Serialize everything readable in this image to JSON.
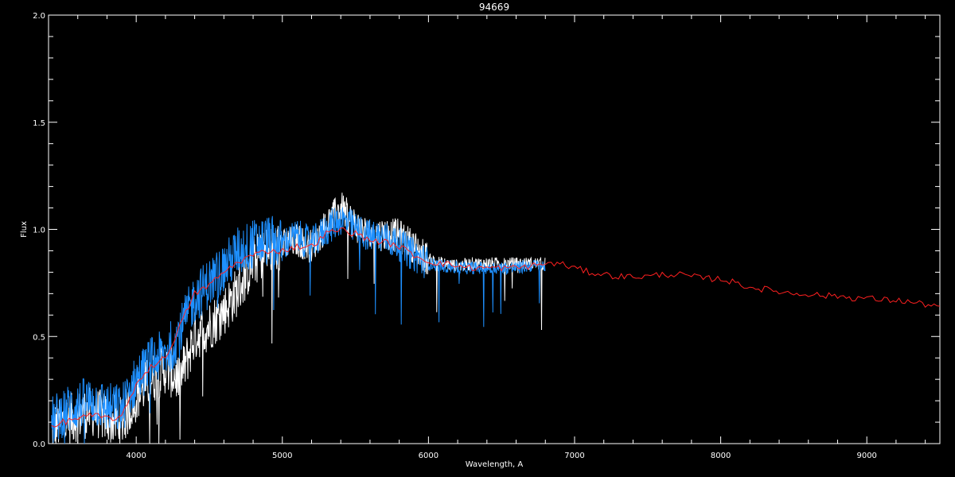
{
  "chart_data": {
    "type": "line",
    "title": "94669",
    "xlabel": "Wavelength, A",
    "ylabel": "Flux",
    "xlim": [
      3400,
      9500
    ],
    "ylim": [
      0.0,
      2.0
    ],
    "x_ticks": [
      4000,
      5000,
      6000,
      7000,
      8000,
      9000
    ],
    "y_ticks": [
      0.0,
      0.5,
      1.0,
      1.5,
      2.0
    ],
    "x_tick_labels": [
      "4000",
      "5000",
      "6000",
      "7000",
      "8000",
      "9000"
    ],
    "y_tick_labels": [
      "0.0",
      "0.5",
      "1.0",
      "1.5",
      "2.0"
    ],
    "grid": false,
    "background": "#000000",
    "axes_color": "#ffffff",
    "series": [
      {
        "color": "#ffffff",
        "x": [
          3420,
          3500,
          3600,
          3700,
          3800,
          3900,
          4000,
          4100,
          4200,
          4300,
          4400,
          4500,
          4600,
          4700,
          4800,
          4900,
          5000,
          5100,
          5200,
          5300,
          5400,
          5500,
          5600,
          5700,
          5800,
          5900,
          6000,
          6100,
          6200,
          6300,
          6400,
          6500,
          6600,
          6700,
          6800
        ],
        "y": [
          0.07,
          0.1,
          0.13,
          0.15,
          0.12,
          0.1,
          0.22,
          0.3,
          0.35,
          0.3,
          0.5,
          0.55,
          0.62,
          0.72,
          0.85,
          0.9,
          0.92,
          0.95,
          0.92,
          1.02,
          1.1,
          1.02,
          0.97,
          0.98,
          0.97,
          0.92,
          0.86,
          0.84,
          0.83,
          0.84,
          0.84,
          0.84,
          0.84,
          0.84,
          0.84
        ]
      },
      {
        "color": "#1e90ff",
        "x": [
          3420,
          3500,
          3600,
          3700,
          3800,
          3900,
          4000,
          4100,
          4200,
          4300,
          4400,
          4500,
          4600,
          4700,
          4800,
          4900,
          5000,
          5100,
          5200,
          5300,
          5400,
          5500,
          5600,
          5700,
          5800,
          5900,
          6000,
          6100,
          6200,
          6300,
          6400,
          6500,
          6600,
          6700,
          6800
        ],
        "y": [
          0.1,
          0.15,
          0.18,
          0.2,
          0.17,
          0.16,
          0.3,
          0.38,
          0.42,
          0.52,
          0.68,
          0.75,
          0.82,
          0.9,
          0.93,
          0.95,
          0.93,
          0.97,
          0.93,
          1.0,
          1.05,
          1.0,
          0.97,
          0.96,
          0.93,
          0.88,
          0.84,
          0.83,
          0.82,
          0.82,
          0.82,
          0.82,
          0.82,
          0.83,
          0.83
        ]
      },
      {
        "color": "#ff2020",
        "x": [
          3420,
          3500,
          3600,
          3700,
          3800,
          3900,
          4000,
          4100,
          4200,
          4300,
          4400,
          4500,
          4600,
          4700,
          4800,
          4900,
          5000,
          5100,
          5200,
          5300,
          5400,
          5500,
          5600,
          5700,
          5800,
          5900,
          6000,
          6100,
          6200,
          6300,
          6400,
          6500,
          6600,
          6700,
          6800,
          6900,
          7000,
          7100,
          7200,
          7300,
          7400,
          7500,
          7600,
          7700,
          7800,
          7900,
          8000,
          8100,
          8200,
          8300,
          8400,
          8500,
          8600,
          8700,
          8800,
          8900,
          9000,
          9100,
          9200,
          9300,
          9400,
          9500
        ],
        "y": [
          0.07,
          0.1,
          0.12,
          0.13,
          0.12,
          0.12,
          0.28,
          0.36,
          0.4,
          0.55,
          0.7,
          0.74,
          0.8,
          0.85,
          0.88,
          0.9,
          0.9,
          0.92,
          0.92,
          0.98,
          1.0,
          0.98,
          0.95,
          0.94,
          0.92,
          0.88,
          0.85,
          0.84,
          0.83,
          0.82,
          0.82,
          0.82,
          0.82,
          0.83,
          0.84,
          0.84,
          0.82,
          0.8,
          0.79,
          0.78,
          0.78,
          0.78,
          0.79,
          0.79,
          0.78,
          0.77,
          0.77,
          0.75,
          0.73,
          0.72,
          0.71,
          0.7,
          0.7,
          0.69,
          0.69,
          0.68,
          0.68,
          0.67,
          0.67,
          0.66,
          0.65,
          0.64
        ]
      }
    ]
  }
}
